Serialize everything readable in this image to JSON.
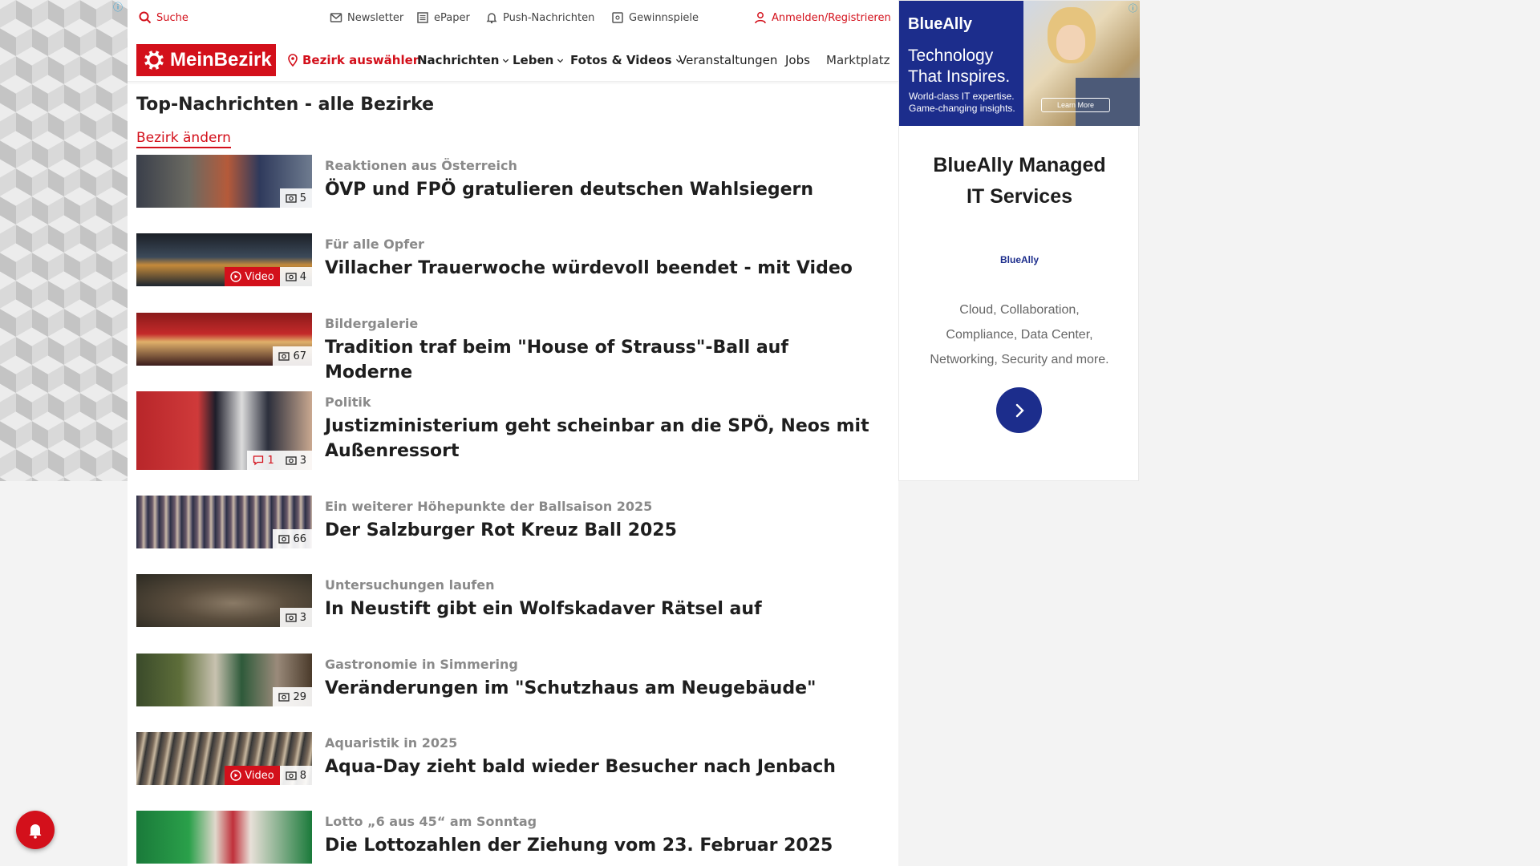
{
  "topbar": {
    "search": "Suche",
    "newsletter": "Newsletter",
    "epaper": "ePaper",
    "push": "Push-Nachrichten",
    "gewinnspiele": "Gewinnspiele",
    "login": "Anmelden/Registrieren"
  },
  "nav": {
    "logo": "MeinBezirk",
    "bezirk": "Bezirk auswählen",
    "items": [
      "Nachrichten",
      "Leben",
      "Fotos & Videos",
      "Veranstaltungen",
      "Jobs",
      "Marktplatz"
    ]
  },
  "main": {
    "title": "Top-Nachrichten - alle Bezirke",
    "change_link": "Bezirk ändern",
    "video_label": "Video",
    "articles": [
      {
        "kicker": "Reaktionen aus Österreich",
        "headline": "ÖVP und FPÖ gratulieren deutschen Wahlsiegern",
        "photos": "5",
        "comments": "",
        "video": false
      },
      {
        "kicker": "Für alle Opfer",
        "headline": "Villacher Trauerwoche würdevoll beendet - mit Video",
        "photos": "4",
        "comments": "",
        "video": true
      },
      {
        "kicker": "Bildergalerie",
        "headline": "Tradition traf beim \"House of Strauss\"-Ball auf Moderne",
        "photos": "67",
        "comments": "",
        "video": false
      },
      {
        "kicker": "Politik",
        "headline": "Justizministerium geht scheinbar an die SPÖ, Neos mit Außenressort",
        "photos": "3",
        "comments": "1",
        "video": false
      },
      {
        "kicker": "Ein weiterer Höhepunkte der Ballsaison 2025",
        "headline": "Der Salzburger Rot Kreuz Ball 2025",
        "photos": "66",
        "comments": "",
        "video": false
      },
      {
        "kicker": "Untersuchungen laufen",
        "headline": "In Neustift gibt ein Wolfskadaver Rätsel auf",
        "photos": "3",
        "comments": "",
        "video": false
      },
      {
        "kicker": "Gastronomie in Simmering",
        "headline": "Veränderungen im \"Schutzhaus am Neugebäude\"",
        "photos": "29",
        "comments": "",
        "video": false
      },
      {
        "kicker": "Aquaristik in 2025",
        "headline": "Aqua-Day zieht bald wieder Besucher nach Jenbach",
        "photos": "8",
        "comments": "",
        "video": true
      },
      {
        "kicker": "Lotto „6 aus 45“ am Sonntag",
        "headline": "Die Lottozahlen der Ziehung vom 23. Februar 2025",
        "photos": "",
        "comments": "",
        "video": false
      }
    ]
  },
  "ad": {
    "brand": "BlueAlly",
    "tagline_1": "Technology",
    "tagline_2": "That Inspires.",
    "sub_1": "World-class IT expertise.",
    "sub_2": "Game-changing insights.",
    "learn_more": "Learn More",
    "title_1": "BlueAlly Managed",
    "title_2": "IT Services",
    "logo_small": "BlueAlly",
    "desc_1": "Cloud, Collaboration,",
    "desc_2": "Compliance, Data Center,",
    "desc_3": "Networking, Security and more."
  },
  "colors": {
    "brand_red": "#d3101b",
    "ad_blue": "#1c2d8c"
  },
  "icons": [
    "search-icon",
    "mail-icon",
    "newspaper-icon",
    "bell-icon",
    "puzzle-icon",
    "user-icon",
    "location-pin-icon",
    "chevron-down-icon",
    "camera-icon",
    "play-icon",
    "comment-icon",
    "arrow-right-icon"
  ]
}
